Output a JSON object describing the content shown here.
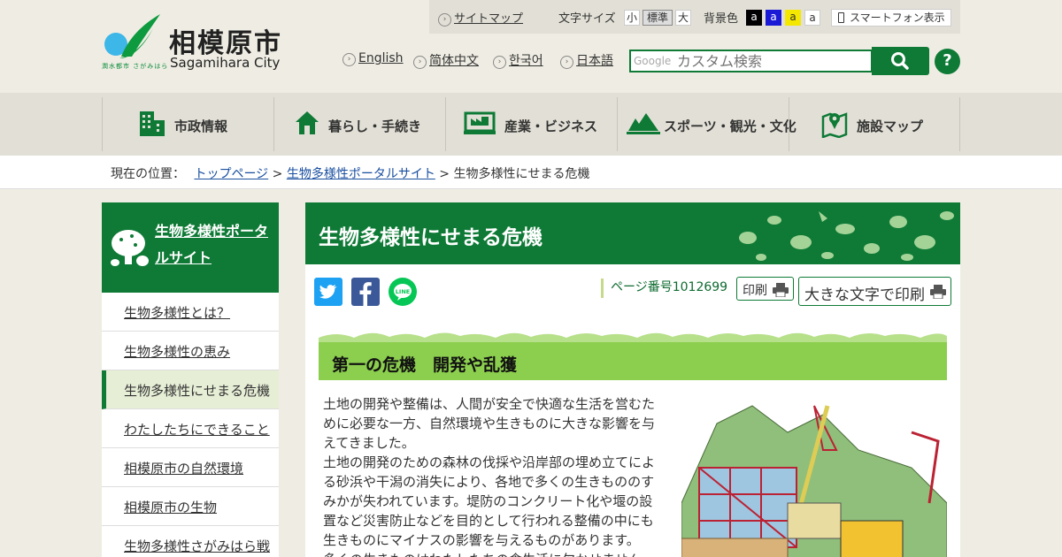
{
  "header": {
    "city_name_ja": "相模原市",
    "city_name_en": "Sagamihara City",
    "logo_subtext": "潤水都市 さがみはら"
  },
  "toolbar": {
    "sitemap": "サイトマップ",
    "font_size_label": "文字サイズ",
    "font_small": "小",
    "font_standard": "標準",
    "font_large": "大",
    "bg_color_label": "背景色",
    "bg_options": [
      "a",
      "a",
      "a",
      "a"
    ],
    "bg_colors": [
      "#000000",
      "#1a1ad6",
      "#f4e800",
      "#ffffff"
    ],
    "smartphone": "スマートフォン表示"
  },
  "languages": [
    "English",
    "简体中文",
    "한국어",
    "日本語"
  ],
  "search": {
    "brand": "Google",
    "placeholder": "カスタム検索",
    "help": "?"
  },
  "gnav": [
    {
      "label": "市政情報",
      "icon": "building-icon"
    },
    {
      "label": "暮らし・手続き",
      "icon": "house-icon"
    },
    {
      "label": "産業・ビジネス",
      "icon": "industry-icon"
    },
    {
      "label": "スポーツ・観光・文化",
      "icon": "mountain-icon"
    },
    {
      "label": "施設マップ",
      "icon": "map-pin-icon"
    }
  ],
  "breadcrumb": {
    "prefix": "現在の位置：",
    "items": [
      "トップページ",
      "生物多様性ポータルサイト"
    ],
    "separator": ">",
    "current": "生物多様性にせまる危機"
  },
  "sidebar": {
    "title": "生物多様性ポータルサイト",
    "items": [
      {
        "label": "生物多様性とは？",
        "current": false
      },
      {
        "label": "生物多様性の恵み",
        "current": false
      },
      {
        "label": "生物多様性にせまる危機",
        "current": true
      },
      {
        "label": "わたしたちにできること",
        "current": false
      },
      {
        "label": "相模原市の自然環境",
        "current": false
      },
      {
        "label": "相模原市の生物",
        "current": false
      },
      {
        "label": "生物多様性さがみはら戦",
        "current": false
      }
    ]
  },
  "main": {
    "title": "生物多様性にせまる危機",
    "share": [
      "twitter-icon",
      "facebook-icon",
      "line-icon"
    ],
    "page_number": "ページ番号1012699",
    "print": "印刷",
    "print_large": "大きな文字で印刷",
    "section_heading": "第一の危機　開発や乱獲",
    "paragraph1": "土地の開発や整備は、人間が安全で快適な生活を営むために必要な一方、自然環境や生きものに大きな影響を与えてきました。",
    "paragraph2": "土地の開発のための森林の伐採や沿岸部の埋め立てによる砂浜や干潟の消失により、各地で多くの生きもののすみかが失われています。堤防のコンクリート化や堰の設置など災害防止などを目的として行われる整備の中にも生きものにマイナスの影響を与えるものがあります。",
    "paragraph3": "多くの生きものはわたしたちの食生活に欠かせません"
  },
  "colors": {
    "brand_green": "#0e7a36",
    "heading_green": "#8ccf4e",
    "link_blue": "#1a4fa0"
  }
}
